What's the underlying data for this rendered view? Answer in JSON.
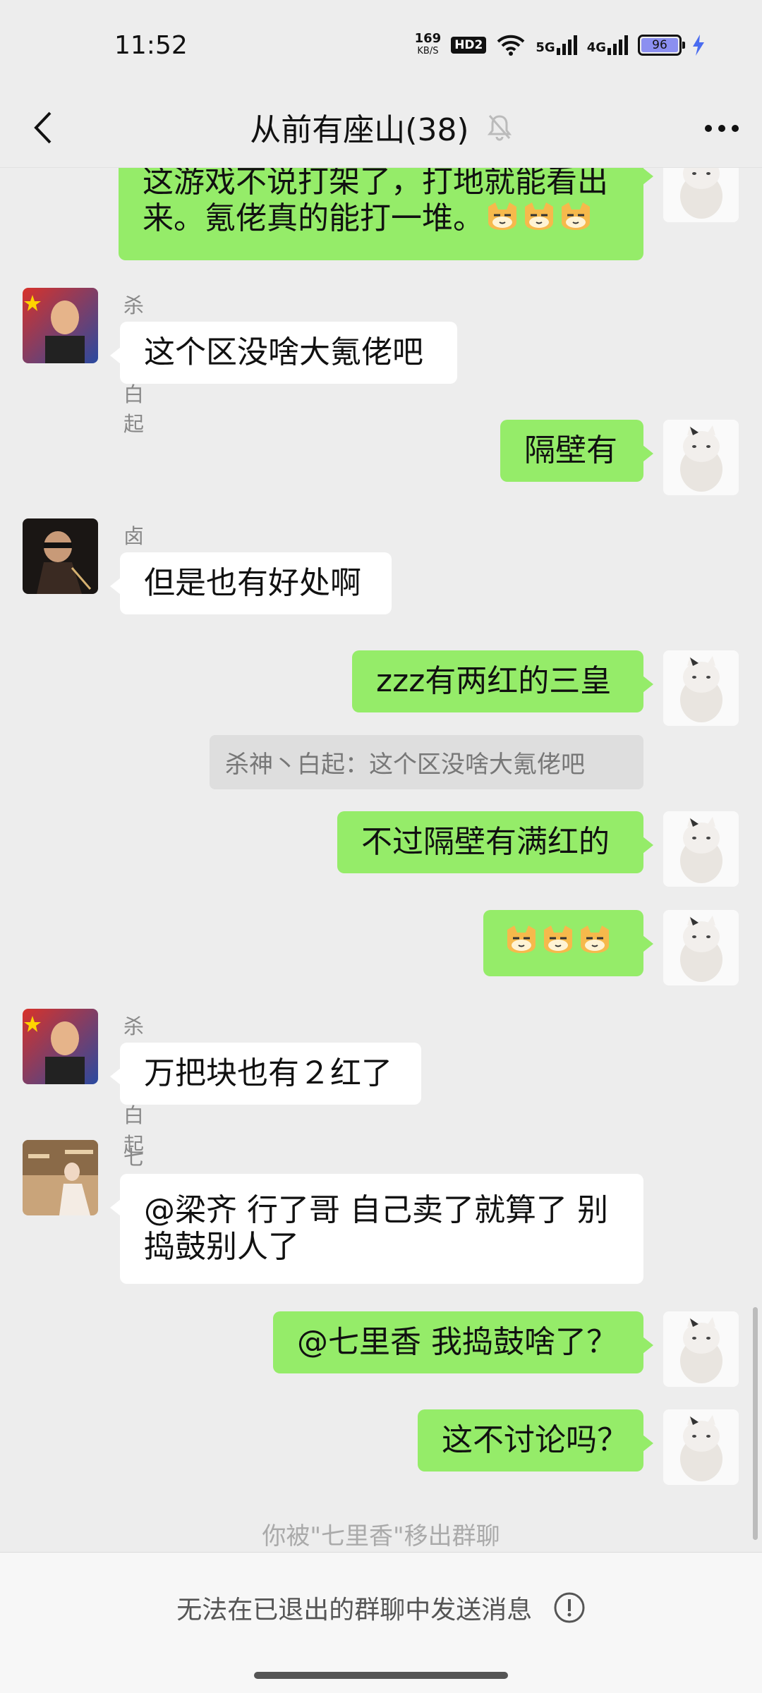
{
  "status_bar": {
    "time": "11:52",
    "net_speed_value": "169",
    "net_speed_unit": "KB/S",
    "hd_badge": "HD2",
    "net_5g": "5G",
    "net_4g": "4G",
    "battery": "96"
  },
  "header": {
    "title": "从前有座山(38)"
  },
  "messages": [
    {
      "from": "me",
      "text_line1": "这游戏不说打架了，打地就能看出",
      "text_line2": "来。氪佬真的能打一堆。"
    },
    {
      "from": "other",
      "sender": "杀神丶白起",
      "text": "这个区没啥大氪佬吧"
    },
    {
      "from": "me",
      "text": "隔壁有"
    },
    {
      "from": "other",
      "sender": "卤蛋",
      "text": "但是也有好处啊"
    },
    {
      "from": "me",
      "text": "zzz有两红的三皇"
    },
    {
      "from": "me",
      "text": "不过隔壁有满红的"
    },
    {
      "from": "me",
      "text": ""
    },
    {
      "from": "other",
      "sender": "杀神丶白起",
      "text": "万把块也有２红了"
    },
    {
      "from": "other",
      "sender": "七里香",
      "text_line1": "@梁齐  行了哥 自己卖了就算了 别",
      "text_line2": "捣鼓别人了"
    },
    {
      "from": "me",
      "text": "@七里香  我捣鼓啥了？"
    },
    {
      "from": "me",
      "text": "这不讨论吗？"
    }
  ],
  "quote": "杀神丶白起：这个区没啥大氪佬吧",
  "system_tip": "你被\"七里香\"移出群聊",
  "bottom": {
    "text": "无法在已退出的群聊中发送消息"
  },
  "colors": {
    "my_bubble": "#95ec69",
    "other_bubble": "#ffffff",
    "background": "#ededed"
  }
}
